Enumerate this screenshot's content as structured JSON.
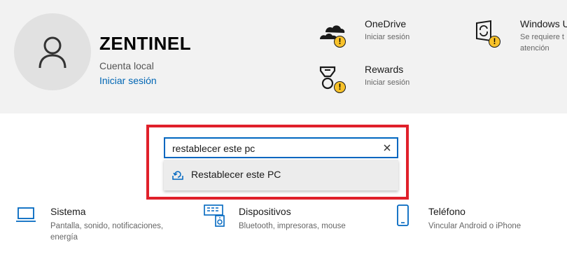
{
  "profile": {
    "name": "ZENTINEL",
    "account_type": "Cuenta local",
    "signin_link": "Iniciar sesión"
  },
  "services": {
    "onedrive": {
      "title": "OneDrive",
      "subtitle": "Iniciar sesión",
      "icon": "cloud-icon",
      "warning_mark": "!"
    },
    "rewards": {
      "title": "Rewards",
      "subtitle": "Iniciar sesión",
      "icon": "medal-icon",
      "warning_mark": "!"
    },
    "windows_update": {
      "title": "Windows U",
      "subtitle_line1": "Se requiere t",
      "subtitle_line2": "atención",
      "icon": "sync-icon",
      "warning_mark": "!"
    }
  },
  "search": {
    "value": "restablecer este pc",
    "clear_icon": "close-icon",
    "suggestion": {
      "label": "Restablecer este PC",
      "icon": "reset-pc-icon"
    }
  },
  "categories": [
    {
      "title": "Sistema",
      "desc_line1": "Pantalla, sonido, notificaciones,",
      "desc_line2": "energía",
      "icon": "laptop-icon"
    },
    {
      "title": "Dispositivos",
      "desc_line1": "Bluetooth, impresoras, mouse",
      "icon": "devices-icon"
    },
    {
      "title": "Teléfono",
      "desc_line1": "Vincular Android o iPhone",
      "icon": "phone-icon"
    }
  ],
  "colors": {
    "accent": "#0067c0",
    "link": "#0066b4",
    "highlight": "#e0202a",
    "warning": "#f8c22a",
    "header_bg": "#f2f2f2"
  }
}
